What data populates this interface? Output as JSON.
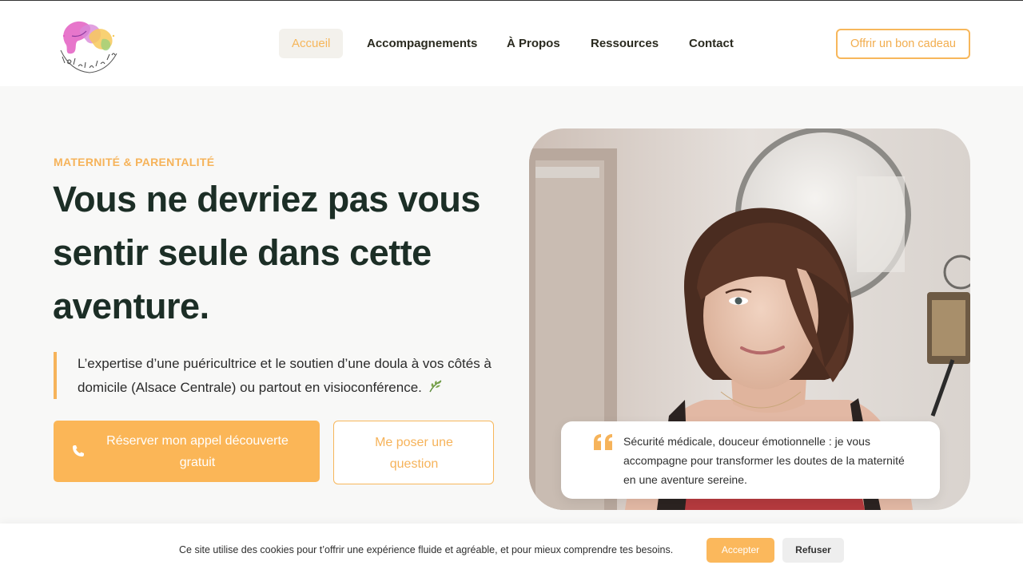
{
  "header": {
    "logo_text": "La Famille ça Grandit",
    "nav": [
      {
        "label": "Accueil",
        "active": true
      },
      {
        "label": "Accompagnements",
        "active": false
      },
      {
        "label": "À Propos",
        "active": false
      },
      {
        "label": "Ressources",
        "active": false
      },
      {
        "label": "Contact",
        "active": false
      }
    ],
    "gift_button": "Offrir un bon cadeau"
  },
  "hero": {
    "eyebrow": "MATERNITÉ & PARENTALITÉ",
    "title": "Vous ne devriez pas vous sentir seule dans cette aventure.",
    "intro": "L’expertise d’une puéricultrice et le soutien d’une doula à vos côtés à domicile (Alsace Centrale) ou partout en visioconférence.",
    "primary_cta": "Réserver mon appel découverte gratuit",
    "secondary_cta": "Me poser une question"
  },
  "quote": {
    "text": "Sécurité médicale, douceur émotionnelle : je vous accompagne pour transformer les doutes de la maternité en une aventure sereine."
  },
  "cookie": {
    "text": "Ce site utilise des cookies pour t’offrir une expérience fluide et agréable, et pour mieux comprendre tes besoins.",
    "accept": "Accepter",
    "refuse": "Refuser"
  },
  "colors": {
    "accent": "#f6b35a",
    "heading": "#1c2e26",
    "background": "#f8f8f7"
  },
  "icons": [
    "phone-icon",
    "leaf-icon",
    "quote-icon"
  ]
}
